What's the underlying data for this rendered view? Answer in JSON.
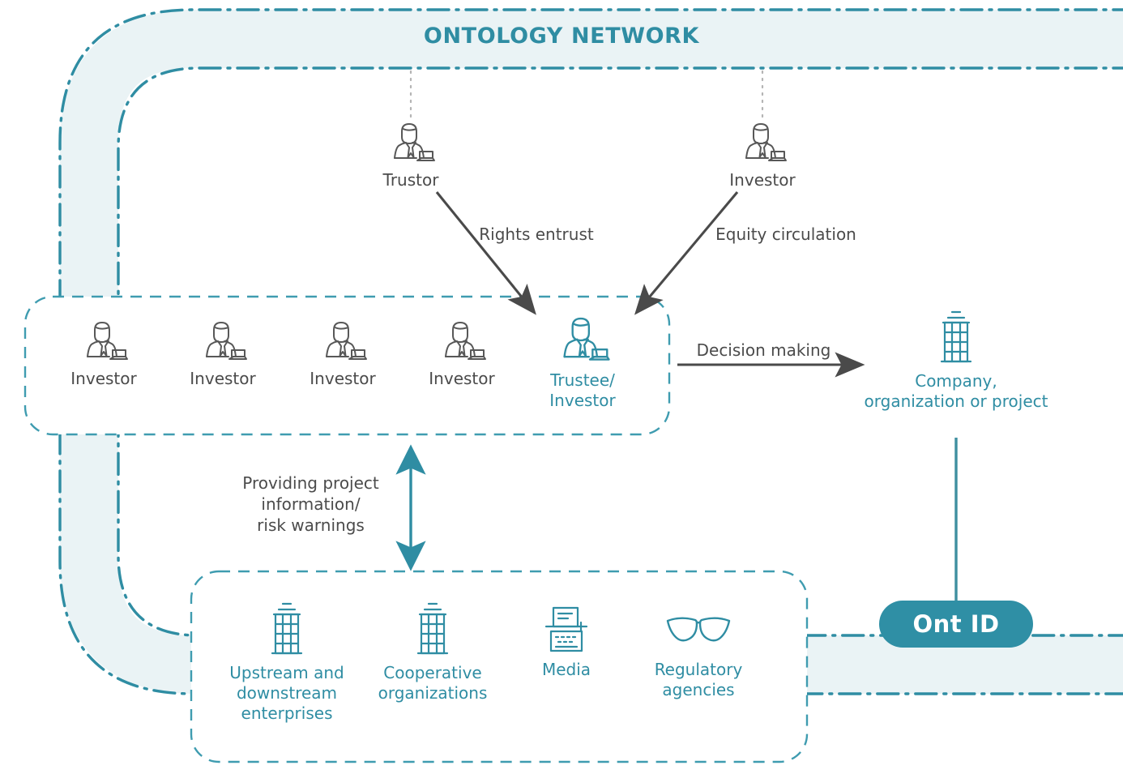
{
  "diagram": {
    "title": "ONTOLOGY NETWORK",
    "colors": {
      "teal": "#2f8da3",
      "teal_dark": "#2f8fa5",
      "band_fill": "#eaf3f5",
      "arrow_gray": "#4a4a4a",
      "text_gray": "#4b4b4b",
      "icon_gray": "#585858"
    }
  },
  "band": {
    "label": "ONTOLOGY NETWORK"
  },
  "ont_id": {
    "label": "Ont ID"
  },
  "top_actors": [
    {
      "label": "Trustor",
      "icon": "businessperson-icon"
    },
    {
      "label": "Investor",
      "icon": "businessperson-icon"
    }
  ],
  "investor_group": {
    "members": [
      {
        "label": "Investor",
        "icon": "businessperson-icon",
        "accent": false
      },
      {
        "label": "Investor",
        "icon": "businessperson-icon",
        "accent": false
      },
      {
        "label": "Investor",
        "icon": "businessperson-icon",
        "accent": false
      },
      {
        "label": "Investor",
        "icon": "businessperson-icon",
        "accent": false
      },
      {
        "label": "Trustee/\nInvestor",
        "icon": "businessperson-icon",
        "accent": true
      }
    ]
  },
  "stakeholder_group": {
    "members": [
      {
        "label": "Upstream and\ndownstream\nenterprises",
        "icon": "building-icon"
      },
      {
        "label": "Cooperative\norganizations",
        "icon": "building-icon"
      },
      {
        "label": "Media",
        "icon": "typewriter-icon"
      },
      {
        "label": "Regulatory\nagencies",
        "icon": "glasses-icon"
      }
    ]
  },
  "company": {
    "label": "Company,\norganization or project",
    "icon": "building-icon"
  },
  "edges": [
    {
      "id": "rights-entrust",
      "label": "Rights entrust",
      "from": "Trustor",
      "to": "Trustee/Investor",
      "style": "solid-gray-arrow"
    },
    {
      "id": "equity-circulation",
      "label": "Equity circulation",
      "from": "Investor",
      "to": "Trustee/Investor",
      "style": "solid-gray-arrow"
    },
    {
      "id": "decision-making",
      "label": "Decision making",
      "from": "Trustee/Investor",
      "to": "Company, organization or project",
      "style": "solid-gray-arrow"
    },
    {
      "id": "providing-project-information",
      "label": "Providing project\ninformation/\nrisk warnings",
      "from": "Investor group",
      "to": "Stakeholder group",
      "style": "teal-double-arrow"
    }
  ]
}
